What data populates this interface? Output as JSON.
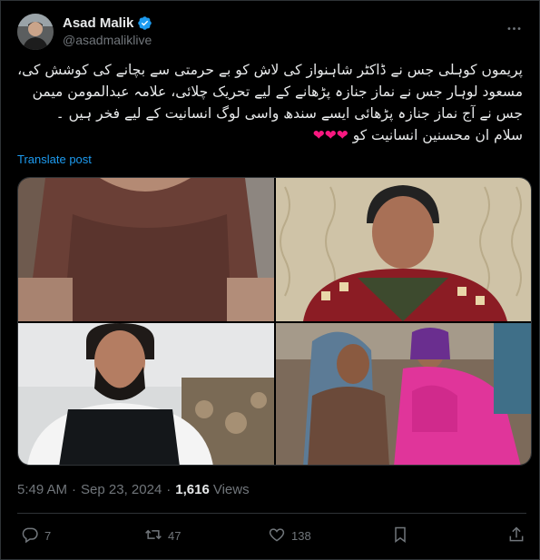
{
  "author": {
    "display_name": "Asad Malik",
    "handle": "@asadmaliklive"
  },
  "post": {
    "lines": [
      "پریموں کوہلی جس نے ڈاکٹر شاہنواز کی لاش کو بے حرمتی سے بچانے کی کوشش کی،",
      "مسعود لوہار جس نے نماز جنازہ پڑھانے کے لیے تحریک چلائی، علامہ عبدالمومن میمن",
      "جس نے آج نماز جنازہ پڑھائی ایسے سندھ واسی لوگ انسانیت کے لیے فخر ہیں ۔",
      "سلام ان محسنین انسانیت کو"
    ],
    "hearts": "❤❤❤",
    "translate_label": "Translate post"
  },
  "media": {
    "images": [
      "photo-1",
      "photo-2",
      "photo-3",
      "photo-4"
    ]
  },
  "meta": {
    "time": "5:49 AM",
    "separator": "·",
    "date": "Sep 23, 2024",
    "views_count": "1,616",
    "views_label": "Views"
  },
  "actions": {
    "replies": "7",
    "reposts": "47",
    "likes": "138"
  },
  "colors": {
    "background": "#000000",
    "text": "#e7e9ea",
    "secondary": "#71767b",
    "link": "#1d9bf0",
    "heart": "#f91880",
    "verified": "#1d9bf0"
  },
  "icons": [
    "verified-badge-icon",
    "more-icon",
    "reply-icon",
    "repost-icon",
    "like-icon",
    "bookmark-icon",
    "share-icon"
  ]
}
